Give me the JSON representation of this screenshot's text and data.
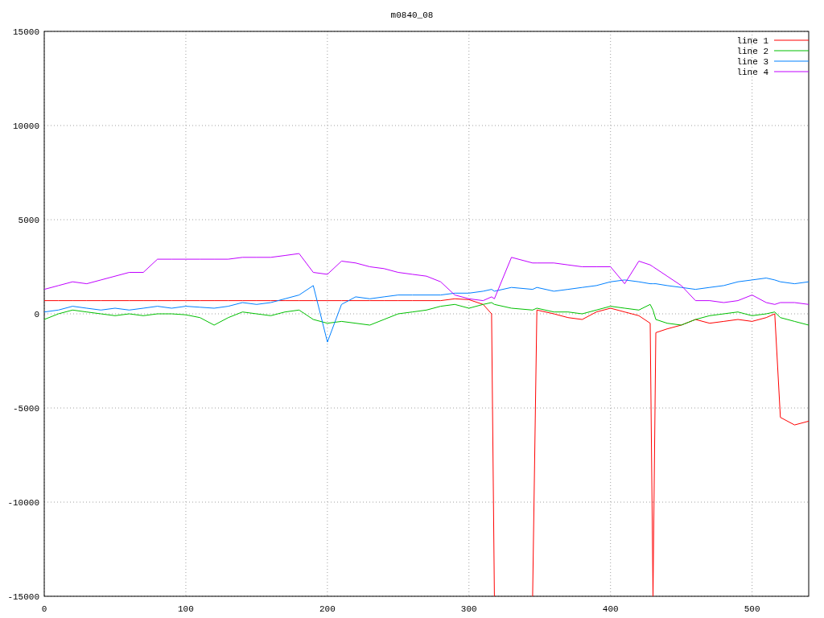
{
  "plot": {
    "chart_data": {
      "type": "line",
      "title": "m0840_08",
      "x": [
        0,
        10,
        20,
        30,
        40,
        50,
        60,
        70,
        80,
        90,
        100,
        110,
        120,
        130,
        140,
        150,
        160,
        170,
        180,
        190,
        200,
        210,
        220,
        230,
        240,
        250,
        260,
        270,
        280,
        290,
        300,
        310,
        316,
        318,
        330,
        345,
        348,
        360,
        370,
        380,
        390,
        400,
        410,
        420,
        428,
        430,
        432,
        440,
        450,
        460,
        470,
        480,
        490,
        500,
        510,
        516,
        520,
        530,
        540
      ],
      "series": [
        {
          "name": "line 1",
          "color": "#ff0000",
          "values": [
            700,
            700,
            700,
            700,
            700,
            700,
            700,
            700,
            700,
            700,
            700,
            700,
            700,
            700,
            700,
            700,
            700,
            700,
            700,
            700,
            700,
            700,
            700,
            700,
            700,
            700,
            700,
            700,
            700,
            800,
            750,
            500,
            0,
            -15000,
            null,
            -15000,
            200,
            0,
            -200,
            -300,
            100,
            300,
            100,
            -100,
            -500,
            -15000,
            -1000,
            -800,
            -600,
            -300,
            -500,
            -400,
            -300,
            -400,
            -200,
            0,
            -5500,
            -5900,
            -5700
          ]
        },
        {
          "name": "line 2",
          "color": "#00c000",
          "values": [
            -300,
            0,
            200,
            100,
            0,
            -100,
            0,
            -100,
            0,
            0,
            -50,
            -200,
            -600,
            -200,
            100,
            0,
            -100,
            100,
            200,
            -300,
            -500,
            -400,
            -500,
            -600,
            -300,
            0,
            100,
            200,
            400,
            500,
            300,
            500,
            600,
            500,
            300,
            200,
            300,
            100,
            100,
            0,
            200,
            400,
            300,
            200,
            500,
            200,
            -300,
            -500,
            -600,
            -300,
            -100,
            0,
            100,
            -100,
            0,
            100,
            -200,
            -400,
            -600
          ]
        },
        {
          "name": "line 3",
          "color": "#0080ff",
          "values": [
            100,
            200,
            400,
            300,
            200,
            300,
            200,
            300,
            400,
            300,
            400,
            350,
            300,
            400,
            600,
            500,
            600,
            800,
            1000,
            1500,
            -1500,
            500,
            900,
            800,
            900,
            1000,
            1000,
            1000,
            1000,
            1100,
            1100,
            1200,
            1300,
            1200,
            1400,
            1300,
            1400,
            1200,
            1300,
            1400,
            1500,
            1700,
            1800,
            1700,
            1600,
            1600,
            1600,
            1500,
            1400,
            1300,
            1400,
            1500,
            1700,
            1800,
            1900,
            1800,
            1700,
            1600,
            1700
          ]
        },
        {
          "name": "line 4",
          "color": "#c000ff",
          "values": [
            1300,
            1500,
            1700,
            1600,
            1800,
            2000,
            2200,
            2200,
            2900,
            2900,
            2900,
            2900,
            2900,
            2900,
            3000,
            3000,
            3000,
            3100,
            3200,
            2200,
            2100,
            2800,
            2700,
            2500,
            2400,
            2200,
            2100,
            2000,
            1700,
            1000,
            800,
            700,
            900,
            800,
            3000,
            2700,
            2700,
            2700,
            2600,
            2500,
            2500,
            2500,
            1600,
            2800,
            2600,
            2500,
            2400,
            2000,
            1500,
            700,
            700,
            600,
            700,
            1000,
            600,
            500,
            600,
            600,
            500
          ]
        }
      ],
      "xlim": [
        0,
        540
      ],
      "ylim": [
        -15000,
        15000
      ],
      "xticks": [
        0,
        100,
        200,
        300,
        400,
        500
      ],
      "yticks": [
        -15000,
        -10000,
        -5000,
        0,
        5000,
        10000,
        15000
      ],
      "grid": true,
      "legend": true
    }
  }
}
